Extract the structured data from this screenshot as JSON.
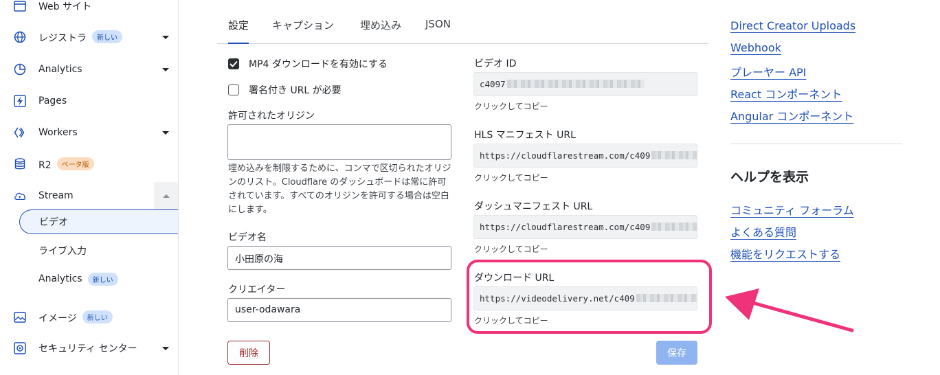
{
  "sidebar": {
    "items": [
      {
        "label": "Web サイト",
        "icon": "browser-window-icon"
      },
      {
        "label": "レジストラ",
        "badge": "新しい",
        "icon": "globe-icon",
        "has_caret": true
      },
      {
        "label": "Analytics",
        "icon": "pie-chart-icon",
        "has_caret": true
      },
      {
        "label": "Pages",
        "icon": "lightning-icon"
      },
      {
        "label": "Workers",
        "icon": "workers-icon",
        "has_caret": true
      },
      {
        "label": "R2",
        "badge": "ベータ版",
        "icon": "database-icon"
      },
      {
        "label": "Stream",
        "icon": "cloud-play-icon"
      },
      {
        "label": "イメージ",
        "badge": "新しい",
        "icon": "image-icon"
      },
      {
        "label": "セキュリティ センター",
        "icon": "security-icon",
        "has_caret": true
      }
    ],
    "stream_sub": [
      {
        "label": "ビデオ",
        "active": true
      },
      {
        "label": "ライブ入力"
      },
      {
        "label": "Analytics",
        "badge": "新しい"
      }
    ]
  },
  "tabs": [
    {
      "label": "設定",
      "active": true
    },
    {
      "label": "キャプション"
    },
    {
      "label": "埋め込み"
    },
    {
      "label": "JSON"
    }
  ],
  "form": {
    "mp4_download_label": "MP4 ダウンロードを有効にする",
    "mp4_download_checked": true,
    "signed_url_label": "署名付き URL が必要",
    "signed_url_checked": false,
    "allowed_origins_label": "許可されたオリジン",
    "allowed_origins_value": "",
    "allowed_origins_help": "埋め込みを制限するために、コンマで区切られたオリジンのリスト。Cloudflare のダッシュボードは常に許可されています。すべてのオリジンを許可する場合は空白にします。",
    "video_name_label": "ビデオ名",
    "video_name_value": "小田原の海",
    "creator_label": "クリエイター",
    "creator_value": "user-odawara",
    "delete_label": "削除",
    "save_label": "保存"
  },
  "details": {
    "copy_hint": "クリックしてコピー",
    "video_id_label": "ビデオ ID",
    "video_id_value": "c4097",
    "hls_label": "HLS マニフェスト URL",
    "hls_value": "https://cloudflarestream.com/c409",
    "dash_label": "ダッシュマニフェスト URL",
    "dash_value": "https://cloudflarestream.com/c409",
    "download_label": "ダウンロード URL",
    "download_value": "https://videodelivery.net/c409"
  },
  "links": [
    "Direct Creator Uploads",
    "Webhook",
    "プレーヤー API",
    "React コンポーネント",
    "Angular コンポーネント"
  ],
  "help": {
    "title": "ヘルプを表示",
    "links": [
      "コミュニティ フォーラム",
      "よくある質問",
      "機能をリクエストする"
    ]
  },
  "colors": {
    "accent": "#1d4fb8",
    "highlight": "#f0327a",
    "danger": "#a32b2b",
    "save_disabled": "#8fb4ef"
  }
}
